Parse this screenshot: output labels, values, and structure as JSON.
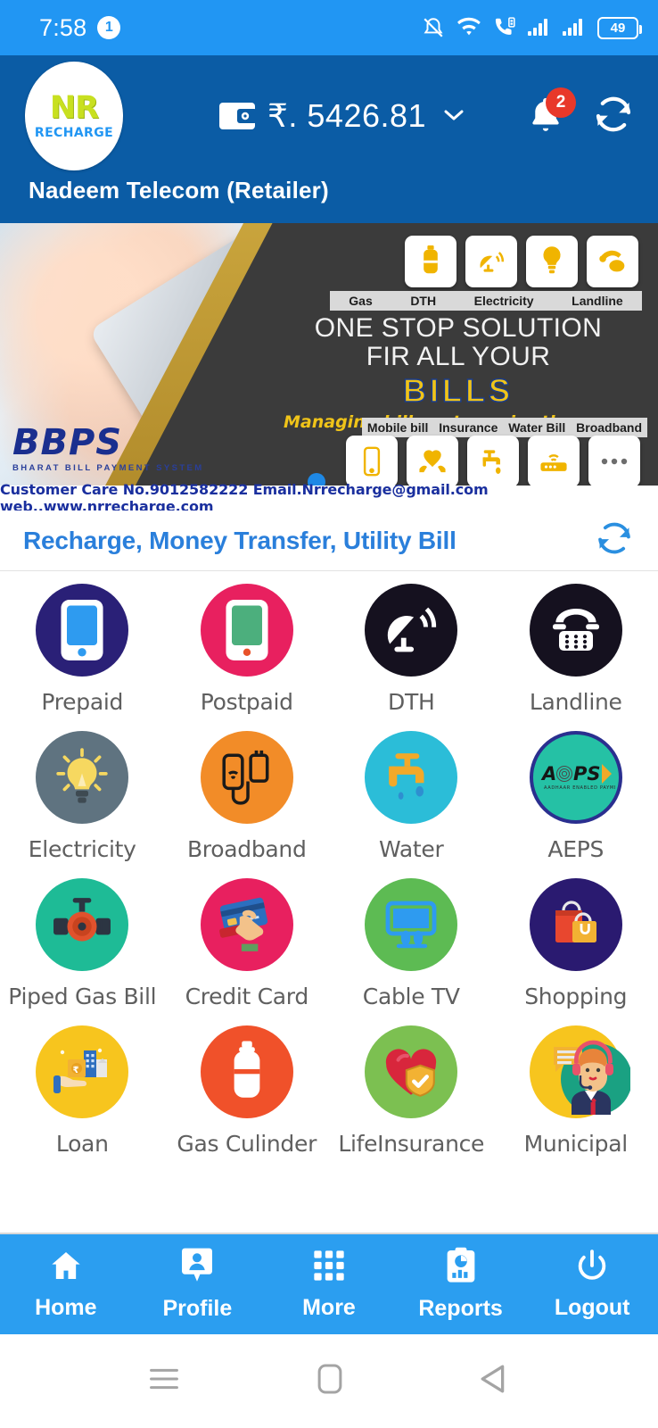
{
  "status_bar": {
    "time": "7:58",
    "notification_count": "1",
    "battery_level": "49",
    "icons": [
      "vibrate-off-icon",
      "wifi-icon",
      "volte-call-icon",
      "signal-bars-icon",
      "signal-bars-icon",
      "battery-icon"
    ]
  },
  "header": {
    "logo_text": "NR",
    "logo_subtext": "RECHARGE",
    "currency_symbol": "₹.",
    "balance": "₹. 5426.81",
    "notification_badge": "2",
    "retailer_name": "Nadeem Telecom (Retailer)",
    "brand_color": "#0b5ca5",
    "status_color": "#2196f3",
    "badge_color": "#e8382a"
  },
  "banner": {
    "headline_line1": "ONE STOP SOLUTION",
    "headline_line2": "FIR ALL YOUR",
    "headline_highlight": "BILLS",
    "tagline": "Managing bills gets easier than ever",
    "bbps_title": "BBPS",
    "bbps_subtitle": "BHARAT BILL PAYMENT SYSTEM",
    "top_labels": [
      "Gas",
      "DTH",
      "Electricity",
      "Landline"
    ],
    "bottom_labels": [
      "Mobile bill",
      "Insurance",
      "Water Bill",
      "Broadband"
    ],
    "footer": "Customer Care No.9012582222 Email.Nrrecharge@gmail.com  web,,www.nrrecharge.com",
    "accent_color": "#f0c419"
  },
  "section": {
    "title": "Recharge, Money Transfer, Utility Bill",
    "title_color": "#2a7fdb",
    "refresh_label": "refresh-icon"
  },
  "services": [
    {
      "label": "Prepaid",
      "icon": "smartphone-icon",
      "bg": "#2a2077",
      "fg": "#ffffff",
      "accent": "#2e9bf0"
    },
    {
      "label": "Postpaid",
      "icon": "smartphone-icon",
      "bg": "#e8205f",
      "fg": "#ffffff",
      "accent": "#4caf7d"
    },
    {
      "label": "DTH",
      "icon": "satellite-dish-icon",
      "bg": "#15111f",
      "fg": "#ffffff",
      "accent": "#ffffff"
    },
    {
      "label": "Landline",
      "icon": "telephone-icon",
      "bg": "#15111f",
      "fg": "#ffffff",
      "accent": "#ffffff"
    },
    {
      "label": "Electricity",
      "icon": "lightbulb-icon",
      "bg": "#5f7380",
      "fg": "#f6d860",
      "accent": "#f6d860"
    },
    {
      "label": "Broadband",
      "icon": "usb-dongle-icon",
      "bg": "#f28c28",
      "fg": "#1a1a1a",
      "accent": "#1a1a1a"
    },
    {
      "label": "Water",
      "icon": "tap-faucet-icon",
      "bg": "#2bbdd8",
      "fg": "#f2a929",
      "accent": "#f2a929"
    },
    {
      "label": "AEPS",
      "icon": "aeps-logo-icon",
      "bg": "#25c1a5",
      "fg": "#1a1a1a",
      "accent": "#2a2f8f"
    },
    {
      "label": "Piped Gas Bill",
      "icon": "gas-pipe-valve-icon",
      "bg": "#1ebb96",
      "fg": "#e0522d",
      "accent": "#1f2733"
    },
    {
      "label": "Credit Card",
      "icon": "credit-card-hand-icon",
      "bg": "#e8205f",
      "fg": "#f3c28a",
      "accent": "#2c6fbf"
    },
    {
      "label": "Cable TV",
      "icon": "television-icon",
      "bg": "#5dbb53",
      "fg": "#2e9bf0",
      "accent": "#2e9bf0"
    },
    {
      "label": "Shopping",
      "icon": "shopping-bags-icon",
      "bg": "#2a1a70",
      "fg": "#e8472f",
      "accent": "#f2b233"
    },
    {
      "label": "Loan",
      "icon": "loan-hand-money-icon",
      "bg": "#f7c51e",
      "fg": "#2e6fbf",
      "accent": "#f3ddb0"
    },
    {
      "label": "Gas Culinder",
      "icon": "gas-cylinder-icon",
      "bg": "#f0512a",
      "fg": "#ffffff",
      "accent": "#ffffff"
    },
    {
      "label": "LifeInsurance",
      "icon": "heart-shield-icon",
      "bg": "#7cc051",
      "fg": "#d8263c",
      "accent": "#f2b233"
    },
    {
      "label": "Municipal",
      "icon": "support-agent-icon",
      "bg": "#f7c51e",
      "fg": "#1aa182",
      "accent": "#2a3560"
    }
  ],
  "bottom_nav": [
    {
      "label": "Home",
      "icon": "home-icon"
    },
    {
      "label": "Profile",
      "icon": "profile-icon"
    },
    {
      "label": "More",
      "icon": "grid-dots-icon"
    },
    {
      "label": "Reports",
      "icon": "clipboard-chart-icon"
    },
    {
      "label": "Logout",
      "icon": "power-icon"
    }
  ],
  "android_nav": [
    {
      "icon": "recents-menu-icon"
    },
    {
      "icon": "home-square-icon"
    },
    {
      "icon": "back-triangle-icon"
    }
  ]
}
